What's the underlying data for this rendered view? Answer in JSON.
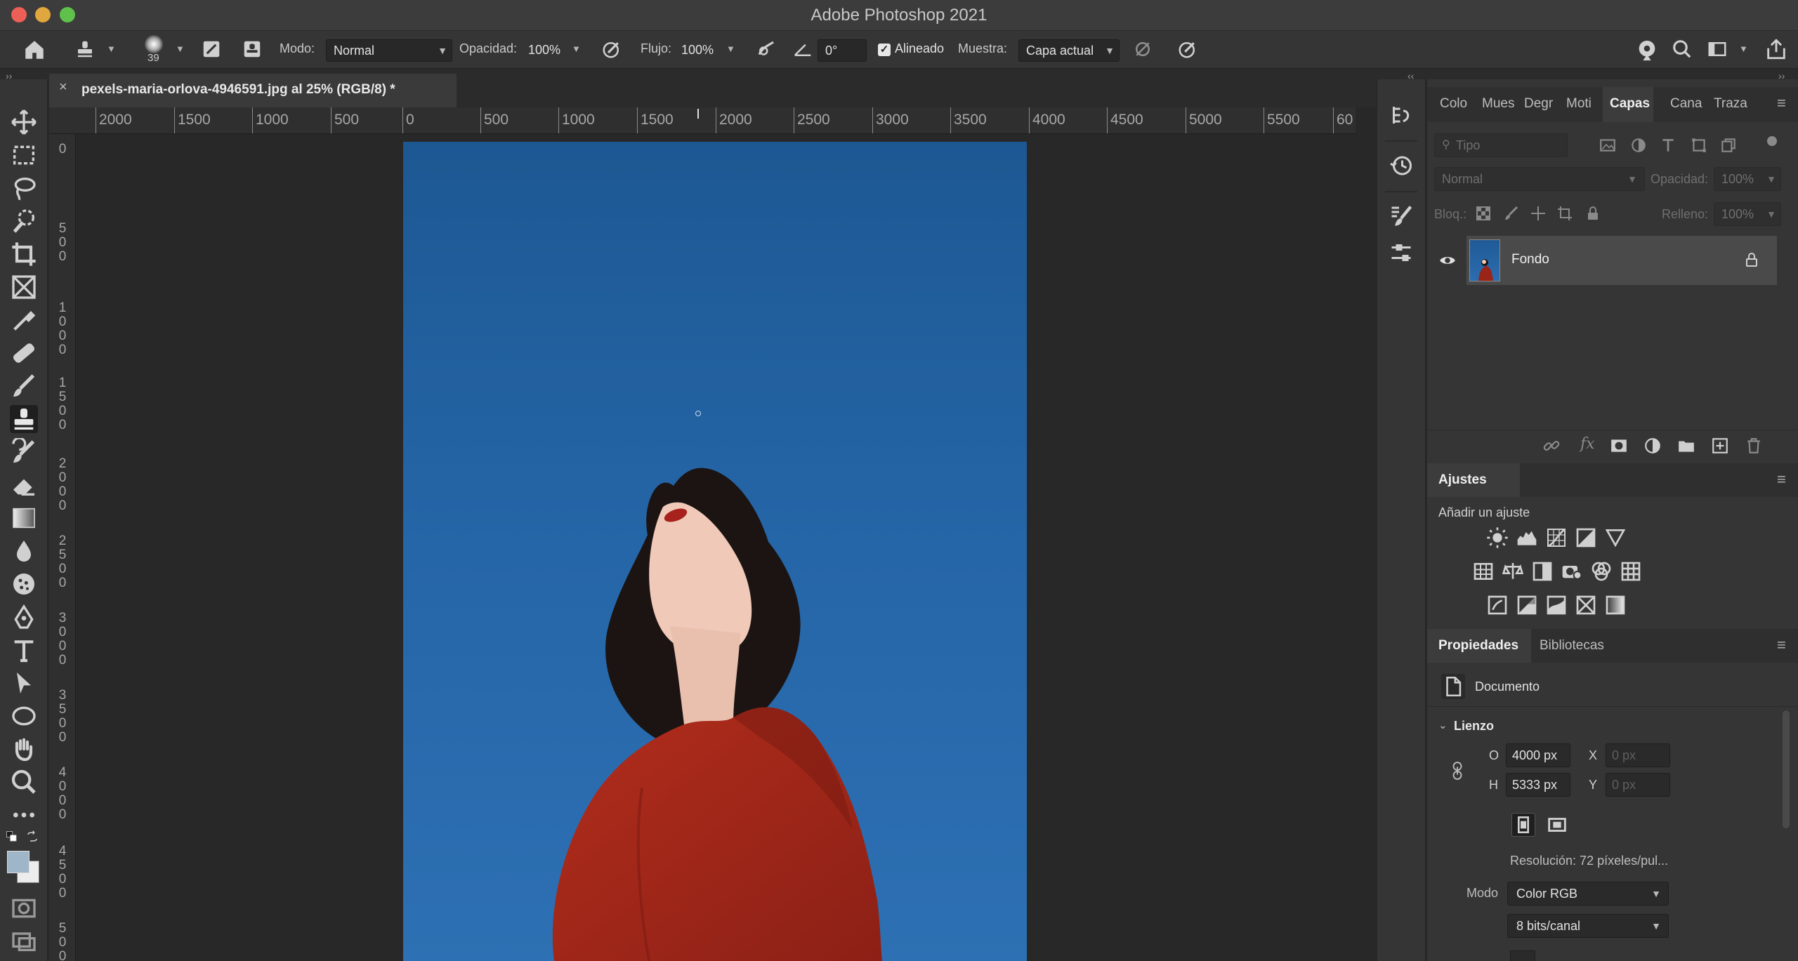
{
  "window": {
    "title": "Adobe Photoshop 2021",
    "traffic_colors": [
      "#ec5f57",
      "#e0a73e",
      "#5fc14b"
    ]
  },
  "options_bar": {
    "brush_size": "39",
    "mode_label": "Modo:",
    "mode_value": "Normal",
    "opacity_label": "Opacidad:",
    "opacity_value": "100%",
    "flow_label": "Flujo:",
    "flow_value": "100%",
    "angle_value": "0°",
    "aligned_label": "Alineado",
    "aligned_checked": true,
    "sample_label": "Muestra:",
    "sample_value": "Capa actual"
  },
  "document": {
    "tab_close": "×",
    "tab_title": "pexels-maria-orlova-4946591.jpg al 25% (RGB/8) *"
  },
  "rulers": {
    "horizontal": [
      "2000",
      "1500",
      "1000",
      "500",
      "0",
      "500",
      "1000",
      "1500",
      "2000",
      "2500",
      "3000",
      "3500",
      "4000",
      "4500",
      "5000",
      "5500",
      "60"
    ],
    "vertical": [
      [
        "0"
      ],
      [
        "5",
        "0",
        "0"
      ],
      [
        "1",
        "0",
        "0",
        "0"
      ],
      [
        "1",
        "5",
        "0",
        "0"
      ],
      [
        "2",
        "0",
        "0",
        "0"
      ],
      [
        "2",
        "5",
        "0",
        "0"
      ],
      [
        "3",
        "0",
        "0",
        "0"
      ],
      [
        "3",
        "5",
        "0",
        "0"
      ],
      [
        "4",
        "0",
        "0",
        "0"
      ],
      [
        "4",
        "5",
        "0",
        "0"
      ],
      [
        "5",
        "0",
        "0"
      ]
    ]
  },
  "panels": {
    "top_tabs": [
      "Colo",
      "Mues",
      "Degr",
      "Moti",
      "Capas",
      "Cana",
      "Traza"
    ],
    "top_tabs_active": "Capas",
    "layers": {
      "filter_placeholder": "Tipo",
      "blend_mode": "Normal",
      "opacity_label": "Opacidad:",
      "opacity_value": "100%",
      "lock_label": "Bloq.:",
      "fill_label": "Relleno:",
      "fill_value": "100%",
      "items": [
        {
          "name": "Fondo",
          "visible": true,
          "locked": true
        }
      ]
    },
    "adjustments": {
      "title": "Ajustes",
      "subtitle": "Añadir un ajuste"
    },
    "properties": {
      "tabs": [
        "Propiedades",
        "Bibliotecas"
      ],
      "doc_label": "Documento",
      "canvas_section": "Lienzo",
      "w_label": "O",
      "w_value": "4000 px",
      "h_label": "H",
      "h_value": "5333 px",
      "x_label": "X",
      "x_placeholder": "0 px",
      "y_label": "Y",
      "y_placeholder": "0 px",
      "resolution": "Resolución: 72 píxeles/pul...",
      "mode_label": "Modo",
      "mode_value": "Color RGB",
      "bits_value": "8 bits/canal"
    }
  },
  "colors": {
    "sky": "#2667a9",
    "dress": "#9b2418",
    "accent": "#3c78c8"
  }
}
